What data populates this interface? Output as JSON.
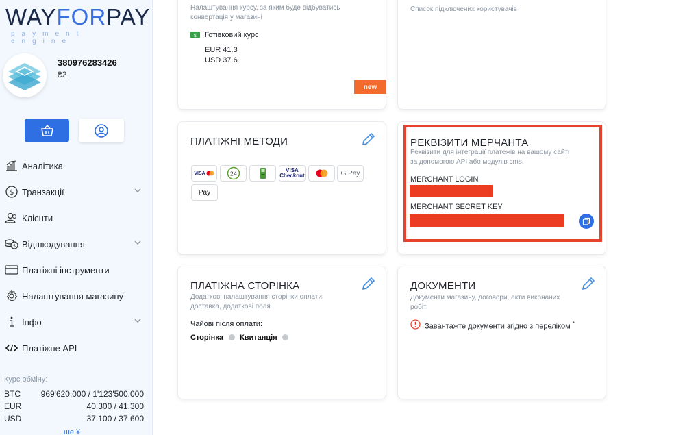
{
  "sidebar": {
    "logo_left": "WAY",
    "logo_accent": "FOR",
    "logo_right": "PAY",
    "logo_sub": "payment engine",
    "user_id": "380976283426",
    "balance": "₴2",
    "nav": [
      {
        "label": "Аналітика",
        "icon": "chart-icon",
        "chevron": false
      },
      {
        "label": "Транзакції",
        "icon": "dollar-circle-icon",
        "chevron": true
      },
      {
        "label": "Клієнти",
        "icon": "users-icon",
        "chevron": false
      },
      {
        "label": "Відшкодування",
        "icon": "coins-icon",
        "chevron": true
      },
      {
        "label": "Платіжні інструменти",
        "icon": "card-icon",
        "chevron": false
      },
      {
        "label": "Налаштування магазину",
        "icon": "gear-icon",
        "chevron": false
      },
      {
        "label": "Інфо",
        "icon": "info-icon",
        "chevron": true
      },
      {
        "label": "Платіжне API",
        "icon": "code-icon",
        "chevron": false
      }
    ],
    "rates_title": "Курс обміну:",
    "rates": [
      {
        "currency": "BTC",
        "value": "969'620.000 / 1'123'500.000"
      },
      {
        "currency": "EUR",
        "value": "40.300 / 41.300"
      },
      {
        "currency": "USD",
        "value": "37.100 / 37.600"
      }
    ],
    "more_link": "ше ¥"
  },
  "cards": {
    "currency": {
      "desc": "Налаштування курсу, за яким буде відбуватись конвертація у магазині",
      "cash_label": "Готівковий курс",
      "eur": "EUR 41.3",
      "usd": "USD 37.6",
      "new_tag": "new"
    },
    "users": {
      "desc": "Список підключених користувачів"
    },
    "payment_methods": {
      "title": "ПЛАТІЖНІ МЕТОДИ",
      "methods": [
        "VISA",
        "24",
        "",
        "VISA Checkout",
        "",
        "G Pay",
        " Pay"
      ]
    },
    "merchant": {
      "title": "РЕКВІЗИТИ МЕРЧАНТА",
      "desc": "Реквізити для інтеграції платежів на вашому сайті за допомогою API або модулів cms.",
      "login_label": "MERCHANT LOGIN",
      "secret_label": "MERCHANT SECRET KEY"
    },
    "payment_page": {
      "title": "ПЛАТІЖНА СТОРІНКА",
      "desc": "Додаткові налаштування сторінки оплати: доставка, додаткові поля",
      "tips_label": "Чайові після оплати:",
      "option1": "Сторінка",
      "option2": "Квитанція"
    },
    "documents": {
      "title": "ДОКУМЕНТИ",
      "desc": "Документи магазину, договори, акти виконаних робіт",
      "notice": "Завантажте документи згідно з переліком",
      "notice_mark": "*"
    }
  },
  "colors": {
    "accent": "#2f6fe4",
    "highlight": "#e8412c",
    "new_tag": "#f26a2c",
    "cash_icon": "#3aa34a"
  }
}
